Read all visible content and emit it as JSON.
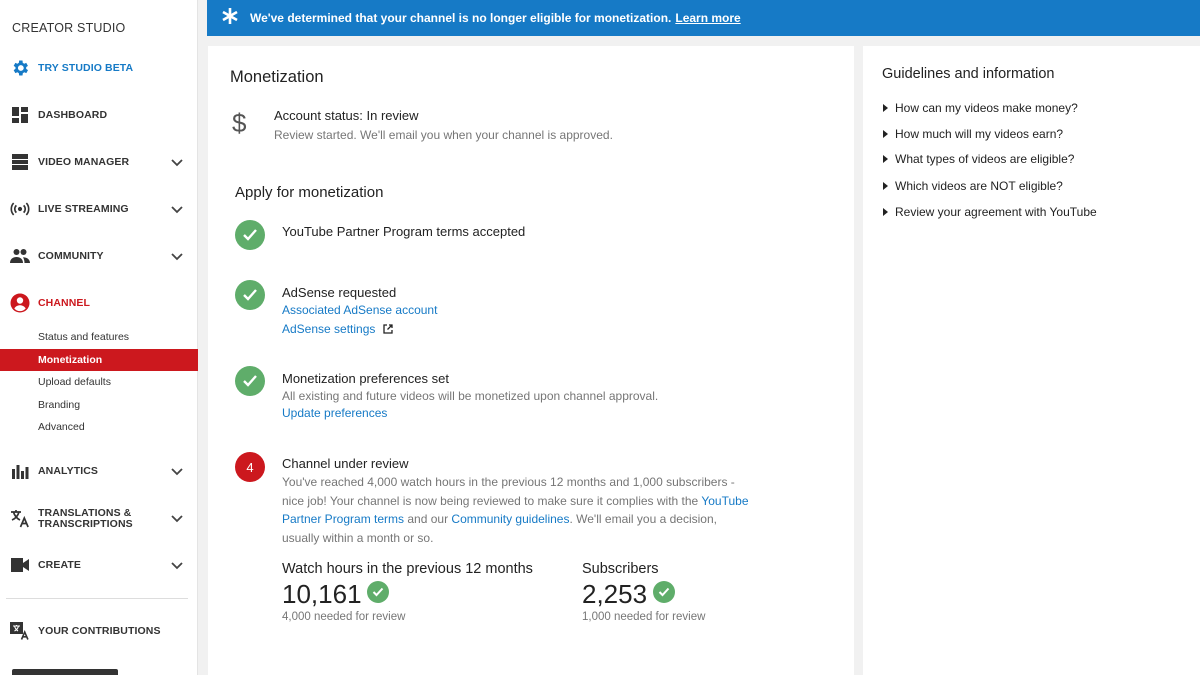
{
  "sidebar": {
    "title": "CREATOR STUDIO",
    "beta": "TRY STUDIO BETA",
    "items": {
      "dashboard": "DASHBOARD",
      "video_manager": "VIDEO MANAGER",
      "live_streaming": "LIVE STREAMING",
      "community": "COMMUNITY",
      "channel": "CHANNEL",
      "analytics": "ANALYTICS",
      "translations_1": "TRANSLATIONS &",
      "translations_2": "TRANSCRIPTIONS",
      "create": "CREATE",
      "contributions": "YOUR CONTRIBUTIONS"
    },
    "channel_sub": {
      "status": "Status and features",
      "monetization": "Monetization",
      "upload": "Upload defaults",
      "branding": "Branding",
      "advanced": "Advanced"
    }
  },
  "banner": {
    "message": "We've determined that your channel is no longer eligible for monetization.",
    "link": "Learn more"
  },
  "main": {
    "title": "Monetization",
    "account_status": "Account status: In review",
    "account_desc": "Review started. We'll email you when your channel is approved.",
    "apply_title": "Apply for monetization",
    "step1": {
      "title": "YouTube Partner Program terms accepted"
    },
    "step2": {
      "title": "AdSense requested",
      "link1": "Associated AdSense account",
      "link2": "AdSense settings"
    },
    "step3": {
      "title": "Monetization preferences set",
      "desc": "All existing and future videos will be monetized upon channel approval.",
      "link": "Update preferences"
    },
    "step4": {
      "number": "4",
      "title": "Channel under review",
      "desc_a": "You've reached 4,000 watch hours in the previous 12 months and 1,000 subscribers - nice job! Your channel is now being reviewed to make sure it complies with the ",
      "link_a": "YouTube Partner Program terms",
      "desc_b": " and our ",
      "link_b": "Community guidelines",
      "desc_c": ". We'll email you a decision, usually within a month or so."
    },
    "watch": {
      "label": "Watch hours in the previous 12 months",
      "value": "10,161",
      "needed": "4,000 needed for review"
    },
    "subs": {
      "label": "Subscribers",
      "value": "2,253",
      "needed": "1,000 needed for review"
    }
  },
  "guidelines": {
    "title": "Guidelines and information",
    "items": [
      "How can my videos make money?",
      "How much will my videos earn?",
      "What types of videos are eligible?",
      "Which videos are NOT eligible?",
      "Review your agreement with YouTube"
    ]
  },
  "colors": {
    "brand_blue": "#167ac6",
    "brand_red": "#cc181e",
    "success_green": "#5fad6a"
  }
}
